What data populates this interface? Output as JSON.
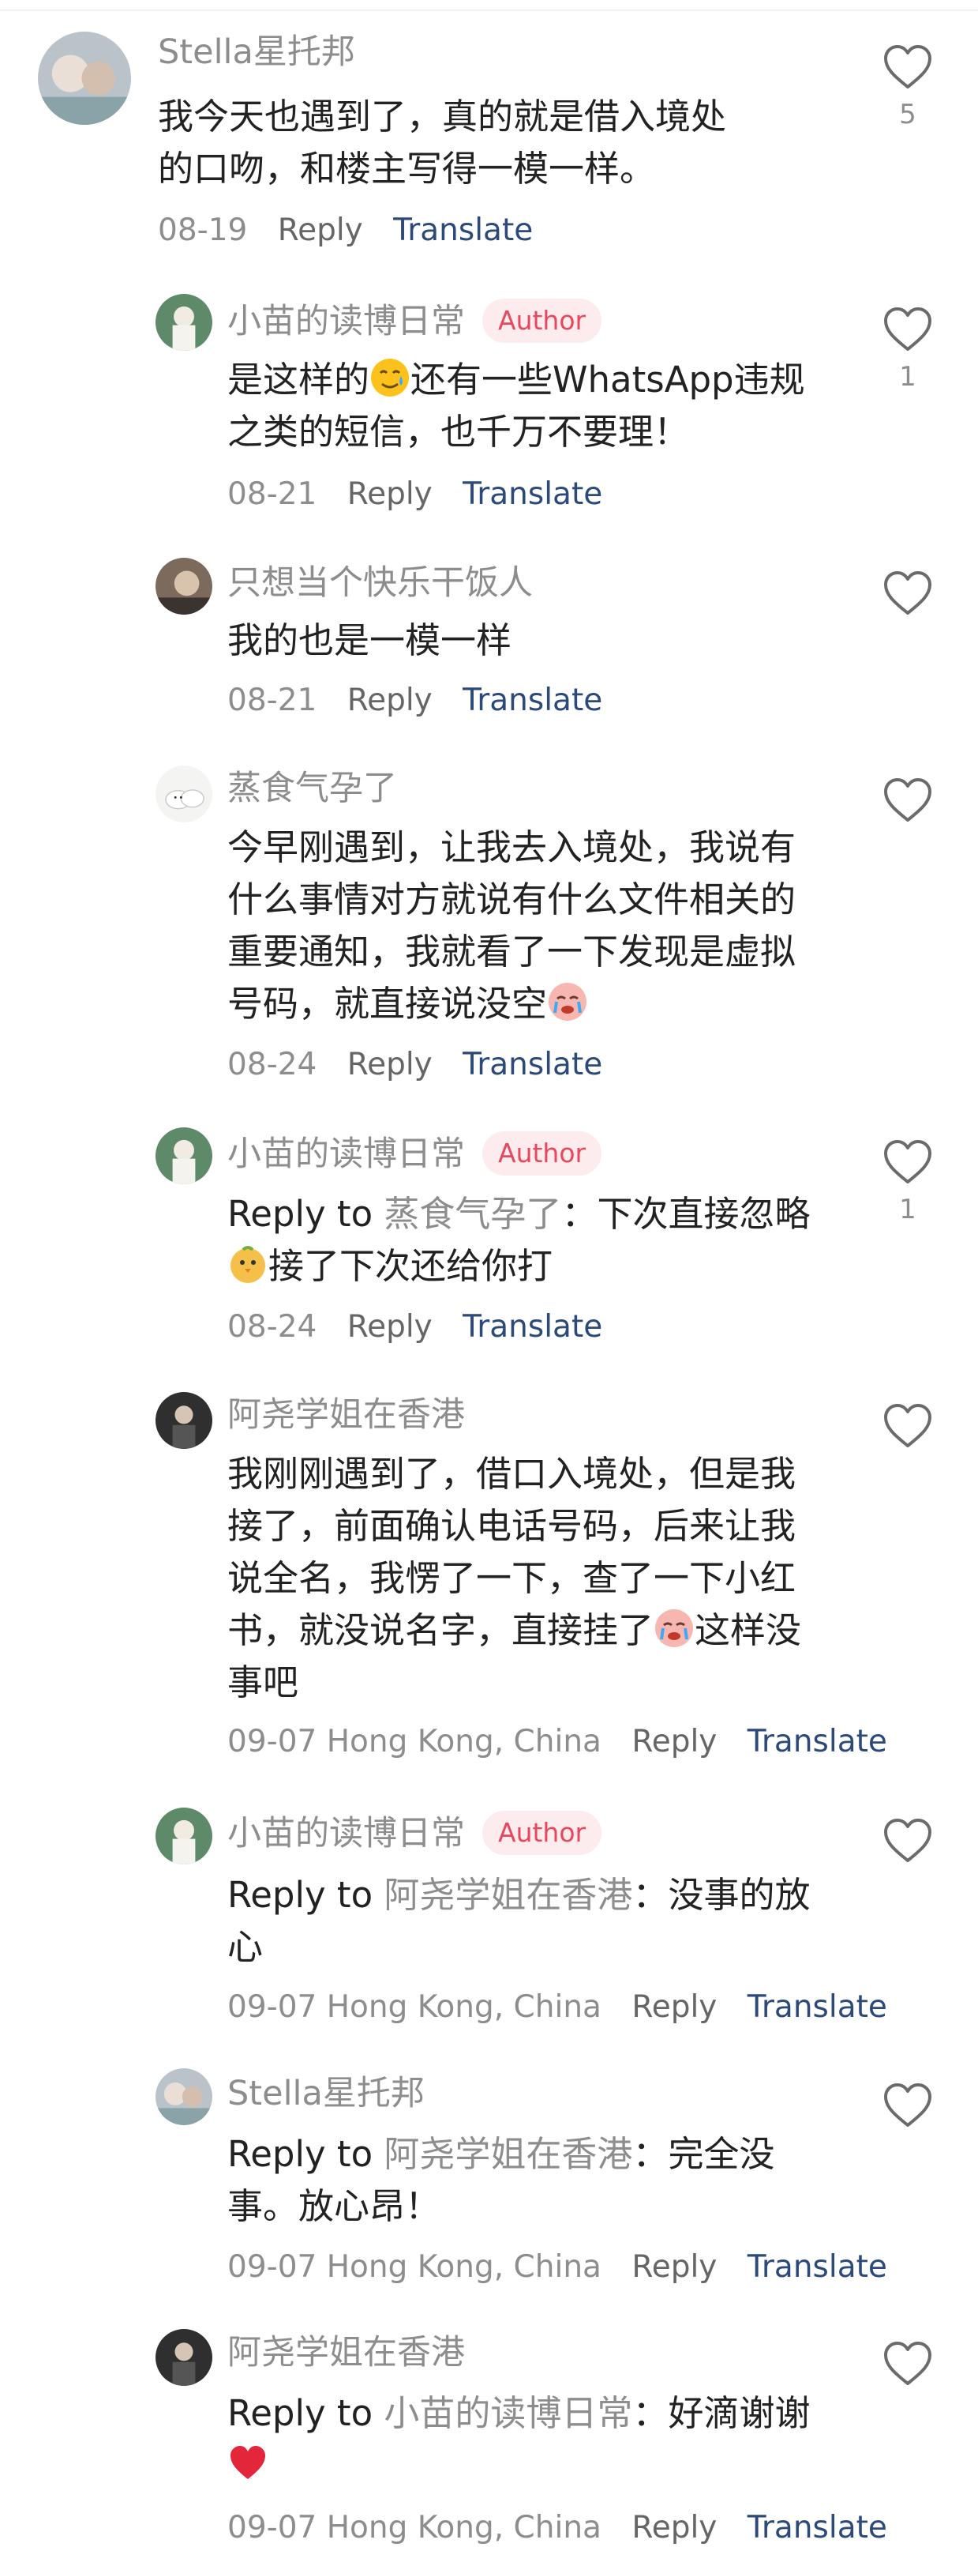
{
  "labels": {
    "reply": "Reply",
    "translate": "Translate",
    "author": "Author",
    "reply_to": "Reply to"
  },
  "comments": [
    {
      "user": "Stella星托邦",
      "author": false,
      "text": "我今天也遇到了，真的就是借入境处的口吻，和楼主写得一模一样。",
      "date": "08-19",
      "likes": "5"
    },
    {
      "user": "小苗的读博日常",
      "author": true,
      "text_a": "是这样的",
      "text_b": "还有一些WhatsApp违规之类的短信，也千万不要理！",
      "date": "08-21",
      "likes": "1"
    },
    {
      "user": "只想当个快乐干饭人",
      "author": false,
      "text": "我的也是一模一样",
      "date": "08-21",
      "likes": ""
    },
    {
      "user": "蒸食气孕了",
      "author": false,
      "text": "今早刚遇到，让我去入境处，我说有什么事情对方就说有什么文件相关的重要通知，我就看了一下发现是虚拟号码，就直接说没空",
      "date": "08-24",
      "likes": ""
    },
    {
      "user": "小苗的读博日常",
      "author": true,
      "reply_to": "蒸食气孕了",
      "text_a": "下次直接忽略",
      "text_b": "接了下次还给你打",
      "date": "08-24",
      "likes": "1"
    },
    {
      "user": "阿尧学姐在香港",
      "author": false,
      "text": "我刚刚遇到了，借口入境处，但是我接了，前面确认电话号码，后来让我说全名，我愣了一下，查了一下小红书，就没说名字，直接挂了",
      "text_b": "这样没事吧",
      "date": "09-07",
      "location": "Hong Kong, China",
      "likes": ""
    },
    {
      "user": "小苗的读博日常",
      "author": true,
      "reply_to": "阿尧学姐在香港",
      "text": "没事的放心",
      "date": "09-07",
      "location": "Hong Kong, China",
      "likes": ""
    },
    {
      "user": "Stella星托邦",
      "author": false,
      "reply_to": "阿尧学姐在香港",
      "text": "完全没事。放心昂！",
      "date": "09-07",
      "location": "Hong Kong, China",
      "likes": ""
    },
    {
      "user": "阿尧学姐在香港",
      "author": false,
      "reply_to": "小苗的读博日常",
      "text": "好滴谢谢",
      "date": "09-07",
      "location": "Hong Kong, China",
      "likes": ""
    }
  ],
  "icons": {
    "like": "heart-outline-icon"
  }
}
